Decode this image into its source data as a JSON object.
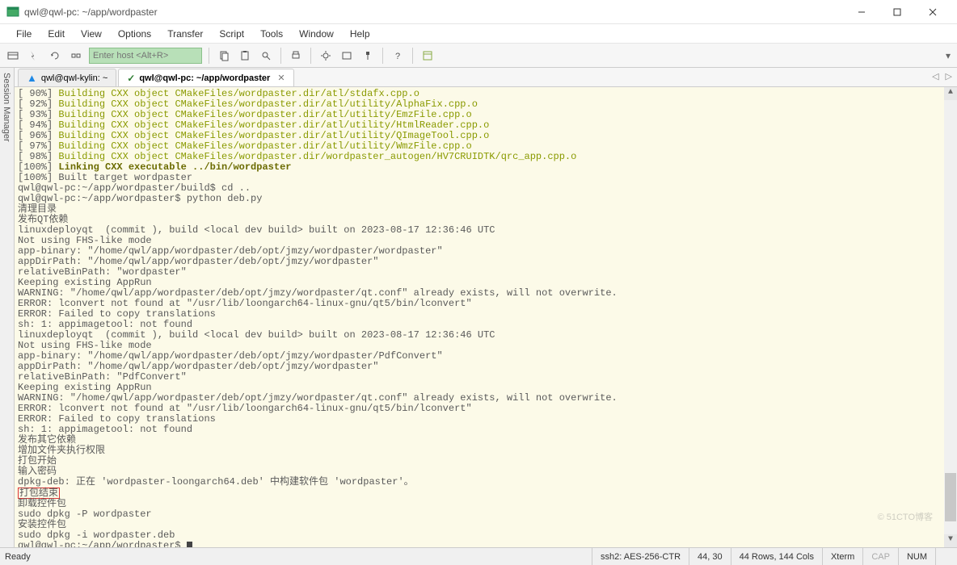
{
  "titlebar": {
    "text": "qwl@qwl-pc: ~/app/wordpaster"
  },
  "menus": [
    "File",
    "Edit",
    "View",
    "Options",
    "Transfer",
    "Script",
    "Tools",
    "Window",
    "Help"
  ],
  "host_placeholder": "Enter host <Alt+R>",
  "side_label": "Session Manager",
  "tabs": [
    {
      "label": "qwl@qwl-kylin: ~",
      "active": false,
      "indicator": "warn"
    },
    {
      "label": "qwl@qwl-pc: ~/app/wordpaster",
      "active": true,
      "indicator": "ok"
    }
  ],
  "term": {
    "build_lines": [
      {
        "pct": "90%",
        "txt": "Building CXX object CMakeFiles/wordpaster.dir/atl/stdafx.cpp.o"
      },
      {
        "pct": "92%",
        "txt": "Building CXX object CMakeFiles/wordpaster.dir/atl/utility/AlphaFix.cpp.o"
      },
      {
        "pct": "93%",
        "txt": "Building CXX object CMakeFiles/wordpaster.dir/atl/utility/EmzFile.cpp.o"
      },
      {
        "pct": "94%",
        "txt": "Building CXX object CMakeFiles/wordpaster.dir/atl/utility/HtmlReader.cpp.o"
      },
      {
        "pct": "96%",
        "txt": "Building CXX object CMakeFiles/wordpaster.dir/atl/utility/QImageTool.cpp.o"
      },
      {
        "pct": "97%",
        "txt": "Building CXX object CMakeFiles/wordpaster.dir/atl/utility/WmzFile.cpp.o"
      },
      {
        "pct": "98%",
        "txt": "Building CXX object CMakeFiles/wordpaster.dir/wordpaster_autogen/HV7CRUIDTK/qrc_app.cpp.o"
      }
    ],
    "link_line": {
      "pct": "100%",
      "txt": "Linking CXX executable ../bin/wordpaster"
    },
    "built_line": "[100%] Built target wordpaster",
    "prompt1": "qwl@qwl-pc:~/app/wordpaster/build$ cd ..",
    "prompt2": "qwl@qwl-pc:~/app/wordpaster$ python deb.py",
    "lines_cn1": "清理目录",
    "lines_cn2": "发布QT依赖",
    "linuxdeploy1": "linuxdeployqt  (commit ), build <local dev build> built on 2023-08-17 12:36:46 UTC",
    "fhs1": "Not using FHS-like mode",
    "appbin1": "app-binary: \"/home/qwl/app/wordpaster/deb/opt/jmzy/wordpaster/wordpaster\"",
    "appdir1": "appDirPath: \"/home/qwl/app/wordpaster/deb/opt/jmzy/wordpaster\"",
    "relbin1": "relativeBinPath: \"wordpaster\"",
    "keep1": "Keeping existing AppRun",
    "warn1": "WARNING: \"/home/qwl/app/wordpaster/deb/opt/jmzy/wordpaster/qt.conf\" already exists, will not overwrite.",
    "err1": "ERROR: lconvert not found at \"/usr/lib/loongarch64-linux-gnu/qt5/bin/lconvert\"",
    "err2": "ERROR: Failed to copy translations",
    "sh1": "sh: 1: appimagetool: not found",
    "linuxdeploy2": "linuxdeployqt  (commit ), build <local dev build> built on 2023-08-17 12:36:46 UTC",
    "fhs2": "Not using FHS-like mode",
    "appbin2": "app-binary: \"/home/qwl/app/wordpaster/deb/opt/jmzy/wordpaster/PdfConvert\"",
    "appdir2": "appDirPath: \"/home/qwl/app/wordpaster/deb/opt/jmzy/wordpaster\"",
    "relbin2": "relativeBinPath: \"PdfConvert\"",
    "keep2": "Keeping existing AppRun",
    "warn2": "WARNING: \"/home/qwl/app/wordpaster/deb/opt/jmzy/wordpaster/qt.conf\" already exists, will not overwrite.",
    "err3": "ERROR: lconvert not found at \"/usr/lib/loongarch64-linux-gnu/qt5/bin/lconvert\"",
    "err4": "ERROR: Failed to copy translations",
    "sh2": "sh: 1: appimagetool: not found",
    "cn3": "发布其它依赖",
    "cn4": "增加文件夹执行权限",
    "cn5": "打包开始",
    "cn6": "输入密码",
    "dpkg": "dpkg-deb: 正在 'wordpaster-loongarch64.deb' 中构建软件包 'wordpaster'。",
    "cn7": "打包结束",
    "cn8": "卸载控件包",
    "sudo1": "sudo dpkg -P wordpaster",
    "cn9": "安装控件包",
    "sudo2": "sudo dpkg -i wordpaster.deb",
    "prompt3": "qwl@qwl-pc:~/app/wordpaster$ "
  },
  "status": {
    "ready": "Ready",
    "conn": "ssh2: AES-256-CTR",
    "pos": "44,   30",
    "size": "44 Rows, 144 Cols",
    "term": "Xterm",
    "cap": "CAP",
    "num": "NUM"
  },
  "watermark": "© 51CTO博客"
}
